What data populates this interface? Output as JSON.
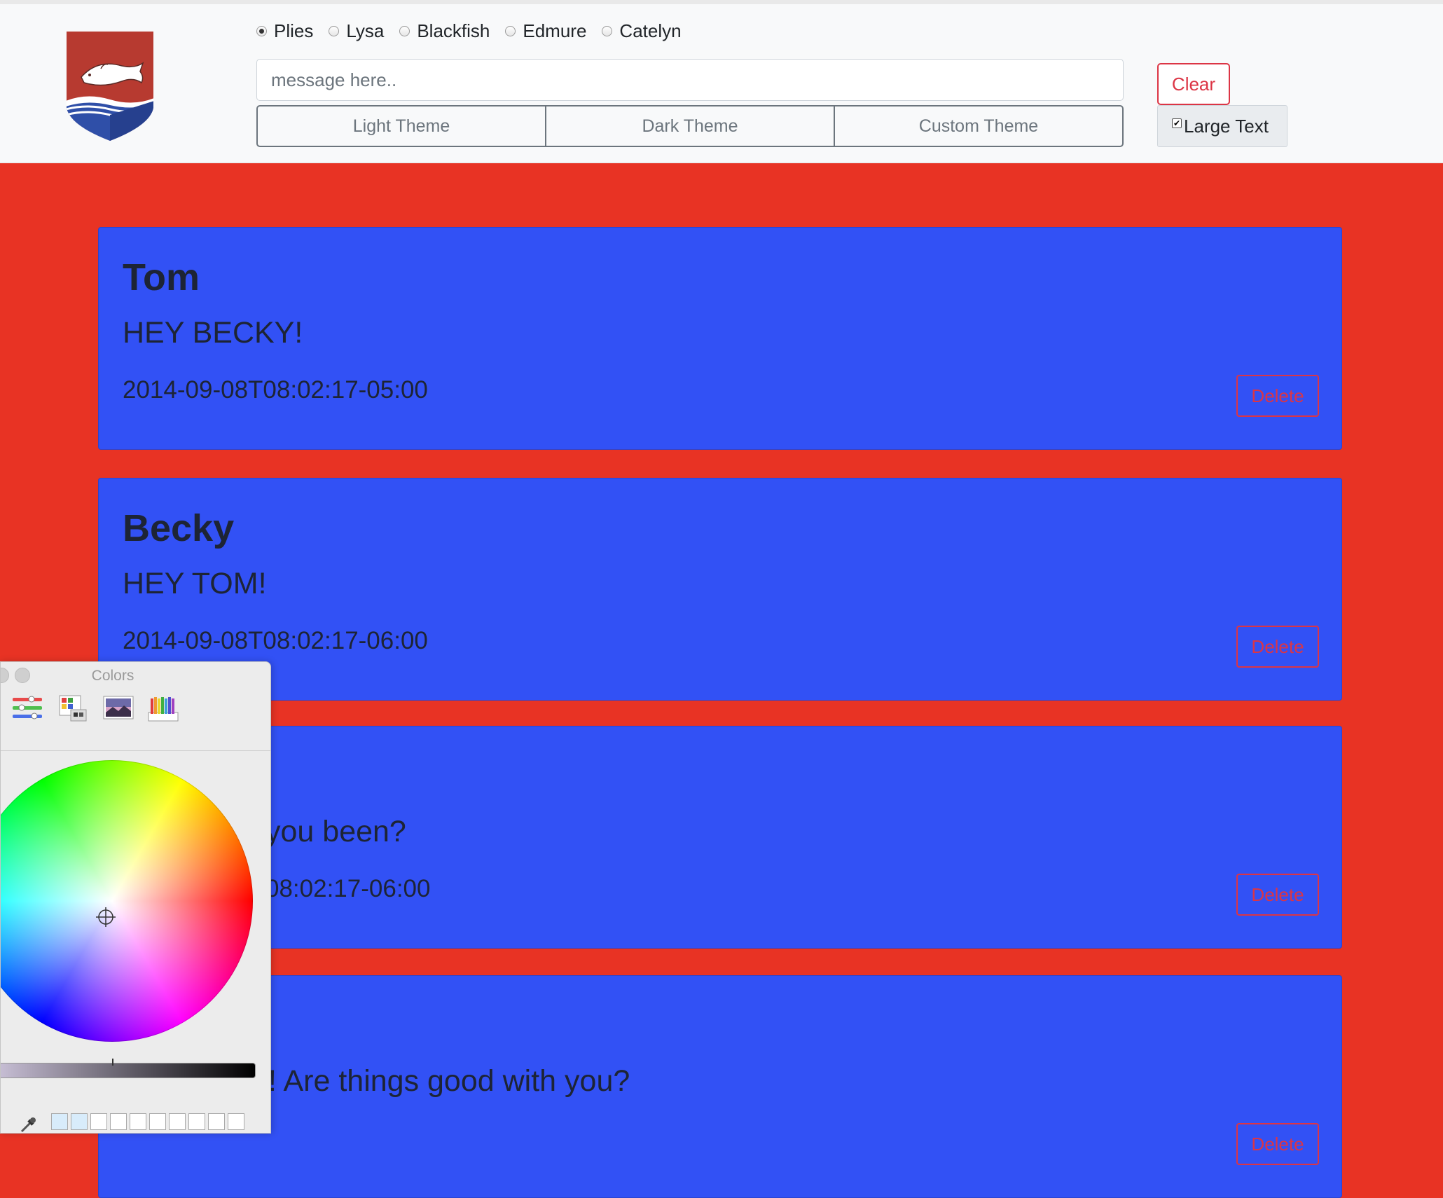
{
  "header": {
    "participants": [
      {
        "label": "Plies",
        "selected": true
      },
      {
        "label": "Lysa",
        "selected": false
      },
      {
        "label": "Blackfish",
        "selected": false
      },
      {
        "label": "Edmure",
        "selected": false
      },
      {
        "label": "Catelyn",
        "selected": false
      }
    ],
    "message_placeholder": "message here..",
    "message_value": "",
    "themes": [
      "Light Theme",
      "Dark Theme",
      "Custom Theme"
    ],
    "clear_label": "Clear",
    "large_text": {
      "label": "Large Text",
      "checked": true
    }
  },
  "messages": [
    {
      "author": "Tom",
      "text": "HEY BECKY!",
      "timestamp": "2014-09-08T08:02:17-05:00",
      "delete_label": "Delete"
    },
    {
      "author": "Becky",
      "text": "HEY TOM!",
      "timestamp": "2014-09-08T08:02:17-06:00",
      "delete_label": "Delete"
    },
    {
      "author": "",
      "text": "you been?",
      "timestamp": "08:02:17-06:00",
      "delete_label": "Delete"
    },
    {
      "author": "",
      "text": "t! Are things good with you?",
      "timestamp": "",
      "delete_label": "Delete"
    }
  ],
  "colors_panel": {
    "title": "Colors",
    "tools": [
      "color-sliders-icon",
      "color-palettes-icon",
      "image-palettes-icon",
      "pencils-icon"
    ]
  },
  "theme_colors": {
    "page_background": "#e83324",
    "card_background": "#3251f5",
    "danger": "#dc3545"
  }
}
